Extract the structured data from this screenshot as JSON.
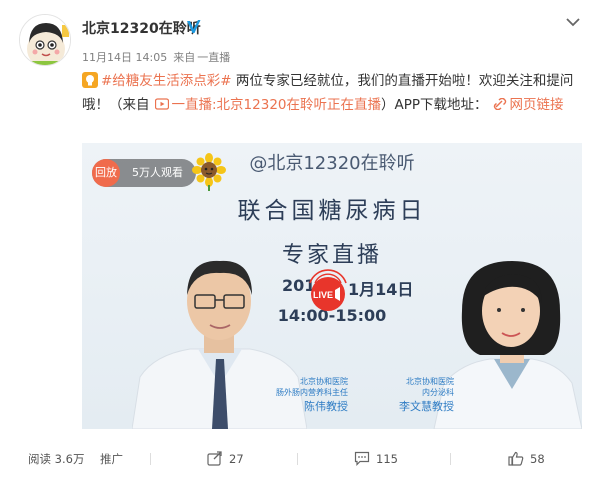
{
  "post": {
    "username": "北京12320在聆听",
    "meta_time": "11月14日 14:05",
    "meta_from": "来自",
    "meta_source": "一直播",
    "topic": "#给糖友生活添点彩#",
    "body_1": " 两位专家已经就位，我们的直播开始啦！欢迎关注和提问哦！（来自",
    "live_link": "一直播:北京12320在聆听正在直播",
    "body_2": "）APP下载地址：",
    "web_link": "网页链接"
  },
  "video": {
    "replay_label": "回放",
    "viewers": "5万人观看",
    "handle": "@北京12320在聆听",
    "title": "联合国糖尿病日",
    "subtitle": "专家直播",
    "date_left": "201",
    "date_right": "1月14日",
    "time": "14:00-15:00",
    "live_label": "LIVE",
    "doctor_left": {
      "line1": "北京协和医院",
      "line2": "肠外肠内营养科主任",
      "name": "陈伟教授"
    },
    "doctor_right": {
      "line1": "北京协和医院",
      "line2": "内分泌科",
      "name": "李文慧教授"
    }
  },
  "actions": {
    "reads": "阅读 3.6万",
    "promote": "推广",
    "reposts": "27",
    "comments": "115",
    "likes": "58"
  },
  "colors": {
    "accent": "#eb7350",
    "verified": "#1e9ae0",
    "live_red": "#e8352b",
    "doctor_caption": "#2e7cc4"
  }
}
